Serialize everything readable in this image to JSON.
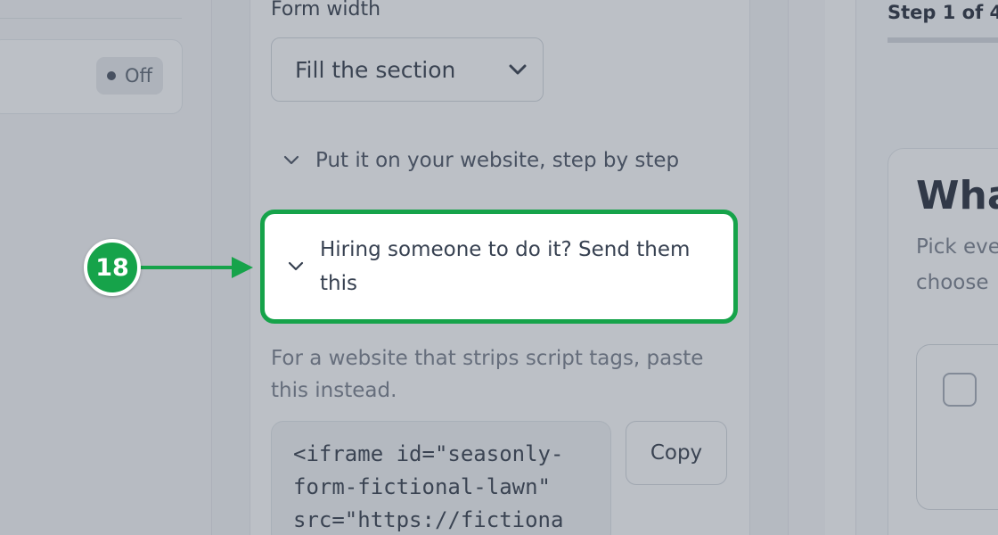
{
  "left_panel": {
    "status_badge": "Off"
  },
  "form_settings": {
    "width_label": "Form width",
    "width_value": "Fill the section",
    "accordion_instructions": "Put it on your website, step by step",
    "accordion_hire": "Hiring someone to do it? Send them this",
    "fallback_hint": "For a website that strips script tags, paste this instead.",
    "code_lines": [
      "<iframe id=\"seasonly-",
      "form-fictional-lawn\"",
      "src=\"https://fictiona"
    ],
    "copy_label": "Copy"
  },
  "preview": {
    "step_text": "Step 1 of 4,",
    "title": "Wha",
    "subtitle_line1": "Pick eve",
    "subtitle_line2": "choose"
  },
  "tutorial": {
    "step_number": "18"
  },
  "colors": {
    "highlight": "#16a34a",
    "overlay": "rgba(96,104,120,0.42)"
  },
  "icons": {
    "select_chevron": "chevron-down-icon",
    "accordion_chevron": "chevron-down-icon"
  }
}
